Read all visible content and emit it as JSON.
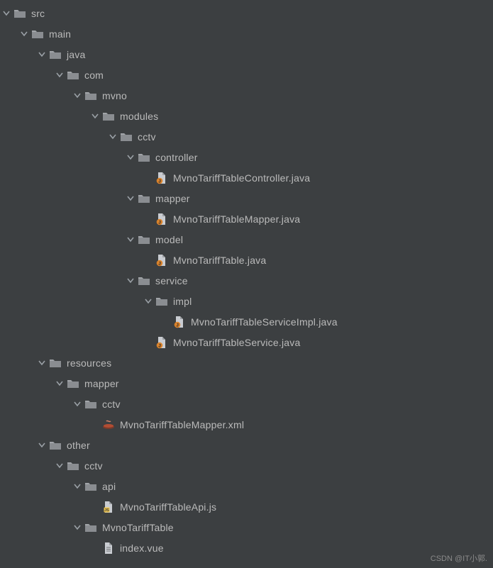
{
  "watermark": "CSDN @IT小郭.",
  "tree": [
    {
      "depth": 0,
      "expanded": true,
      "icon": "folder",
      "label": "src"
    },
    {
      "depth": 1,
      "expanded": true,
      "icon": "folder",
      "label": "main"
    },
    {
      "depth": 2,
      "expanded": true,
      "icon": "folder",
      "label": "java"
    },
    {
      "depth": 3,
      "expanded": true,
      "icon": "folder",
      "label": "com"
    },
    {
      "depth": 4,
      "expanded": true,
      "icon": "folder",
      "label": "mvno"
    },
    {
      "depth": 5,
      "expanded": true,
      "icon": "folder",
      "label": "modules"
    },
    {
      "depth": 6,
      "expanded": true,
      "icon": "folder",
      "label": "cctv"
    },
    {
      "depth": 7,
      "expanded": true,
      "icon": "folder",
      "label": "controller"
    },
    {
      "depth": 8,
      "expanded": null,
      "icon": "java",
      "label": "MvnoTariffTableController.java"
    },
    {
      "depth": 7,
      "expanded": true,
      "icon": "folder",
      "label": "mapper"
    },
    {
      "depth": 8,
      "expanded": null,
      "icon": "java",
      "label": "MvnoTariffTableMapper.java"
    },
    {
      "depth": 7,
      "expanded": true,
      "icon": "folder",
      "label": "model"
    },
    {
      "depth": 8,
      "expanded": null,
      "icon": "java",
      "label": "MvnoTariffTable.java"
    },
    {
      "depth": 7,
      "expanded": true,
      "icon": "folder",
      "label": "service"
    },
    {
      "depth": 8,
      "expanded": true,
      "icon": "folder",
      "label": "impl"
    },
    {
      "depth": 9,
      "expanded": null,
      "icon": "java",
      "label": "MvnoTariffTableServiceImpl.java"
    },
    {
      "depth": 8,
      "expanded": null,
      "icon": "java",
      "label": "MvnoTariffTableService.java"
    },
    {
      "depth": 2,
      "expanded": true,
      "icon": "folder",
      "label": "resources"
    },
    {
      "depth": 3,
      "expanded": true,
      "icon": "folder",
      "label": "mapper"
    },
    {
      "depth": 4,
      "expanded": true,
      "icon": "folder",
      "label": "cctv"
    },
    {
      "depth": 5,
      "expanded": null,
      "icon": "xml",
      "label": "MvnoTariffTableMapper.xml"
    },
    {
      "depth": 2,
      "expanded": true,
      "icon": "folder",
      "label": "other"
    },
    {
      "depth": 3,
      "expanded": true,
      "icon": "folder",
      "label": "cctv"
    },
    {
      "depth": 4,
      "expanded": true,
      "icon": "folder",
      "label": "api"
    },
    {
      "depth": 5,
      "expanded": null,
      "icon": "js",
      "label": "MvnoTariffTableApi.js"
    },
    {
      "depth": 4,
      "expanded": true,
      "icon": "folder",
      "label": "MvnoTariffTable"
    },
    {
      "depth": 5,
      "expanded": null,
      "icon": "file",
      "label": "index.vue"
    }
  ]
}
